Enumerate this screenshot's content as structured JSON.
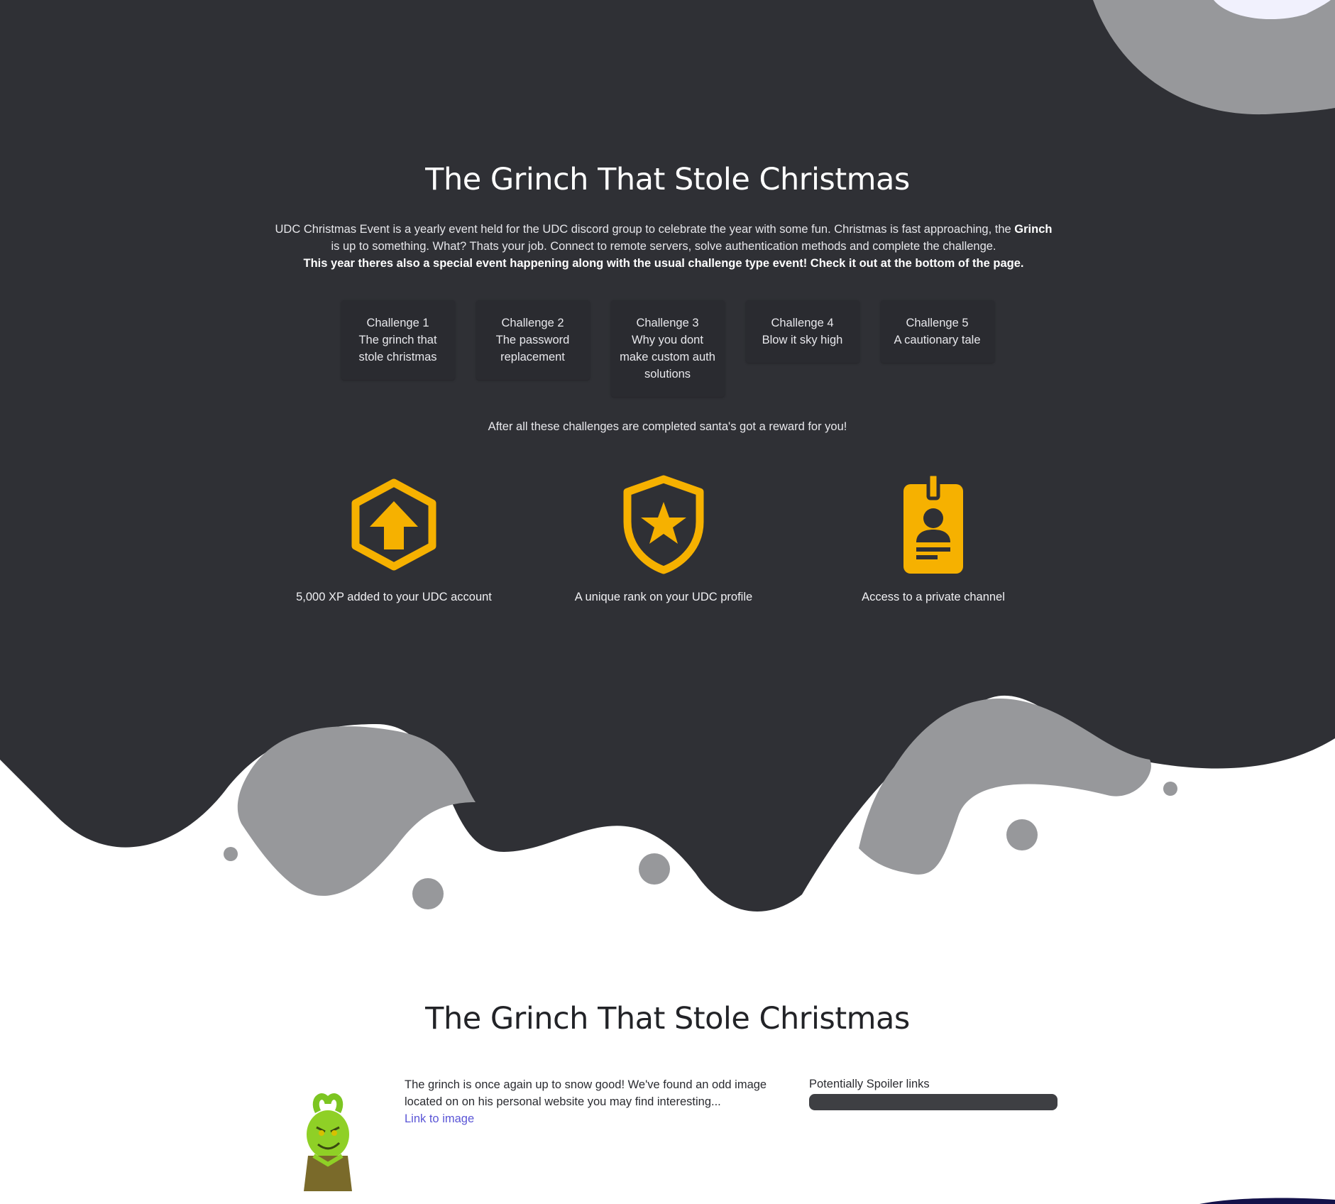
{
  "hero": {
    "title": "The Grinch That Stole Christmas",
    "intro_part1": "UDC Christmas Event is a yearly event held for the UDC discord group to celebrate the year with some fun. Christmas is fast approaching, the ",
    "intro_bold": "Grinch",
    "intro_part2": " is up to something. What? Thats your job. Connect to remote servers, solve authentication methods and complete the challenge.",
    "special_notice": "This year theres also a special event happening along with the usual challenge type event! Check it out at the bottom of the page."
  },
  "challenges": [
    {
      "number": "Challenge 1",
      "name": "The grinch that stole christmas"
    },
    {
      "number": "Challenge 2",
      "name": "The password replacement"
    },
    {
      "number": "Challenge 3",
      "name": "Why you dont make custom auth solutions"
    },
    {
      "number": "Challenge 4",
      "name": "Blow it sky high"
    },
    {
      "number": "Challenge 5",
      "name": "A cautionary tale"
    }
  ],
  "rewards": {
    "intro": "After all these challenges are completed santa's got a reward for you!",
    "items": [
      {
        "icon": "hexagon-arrow-up-icon",
        "label": "5,000 XP added to your UDC account"
      },
      {
        "icon": "shield-star-icon",
        "label": "A unique rank on your UDC profile"
      },
      {
        "icon": "id-badge-icon",
        "label": "Access to a private channel"
      }
    ]
  },
  "challenge_section": {
    "title": "The Grinch That Stole Christmas",
    "description": "The grinch is once again up to snow good! We've found an odd image located on on his personal website you may find interesting...",
    "link_text": "Link to image",
    "spoiler_label": "Potentially Spoiler links"
  },
  "colors": {
    "dark_bg": "#2f3035",
    "blob_gray": "#97989b",
    "accent_yellow": "#f6b100",
    "link_color": "#5a55d6",
    "navy_corner": "#14124a"
  }
}
